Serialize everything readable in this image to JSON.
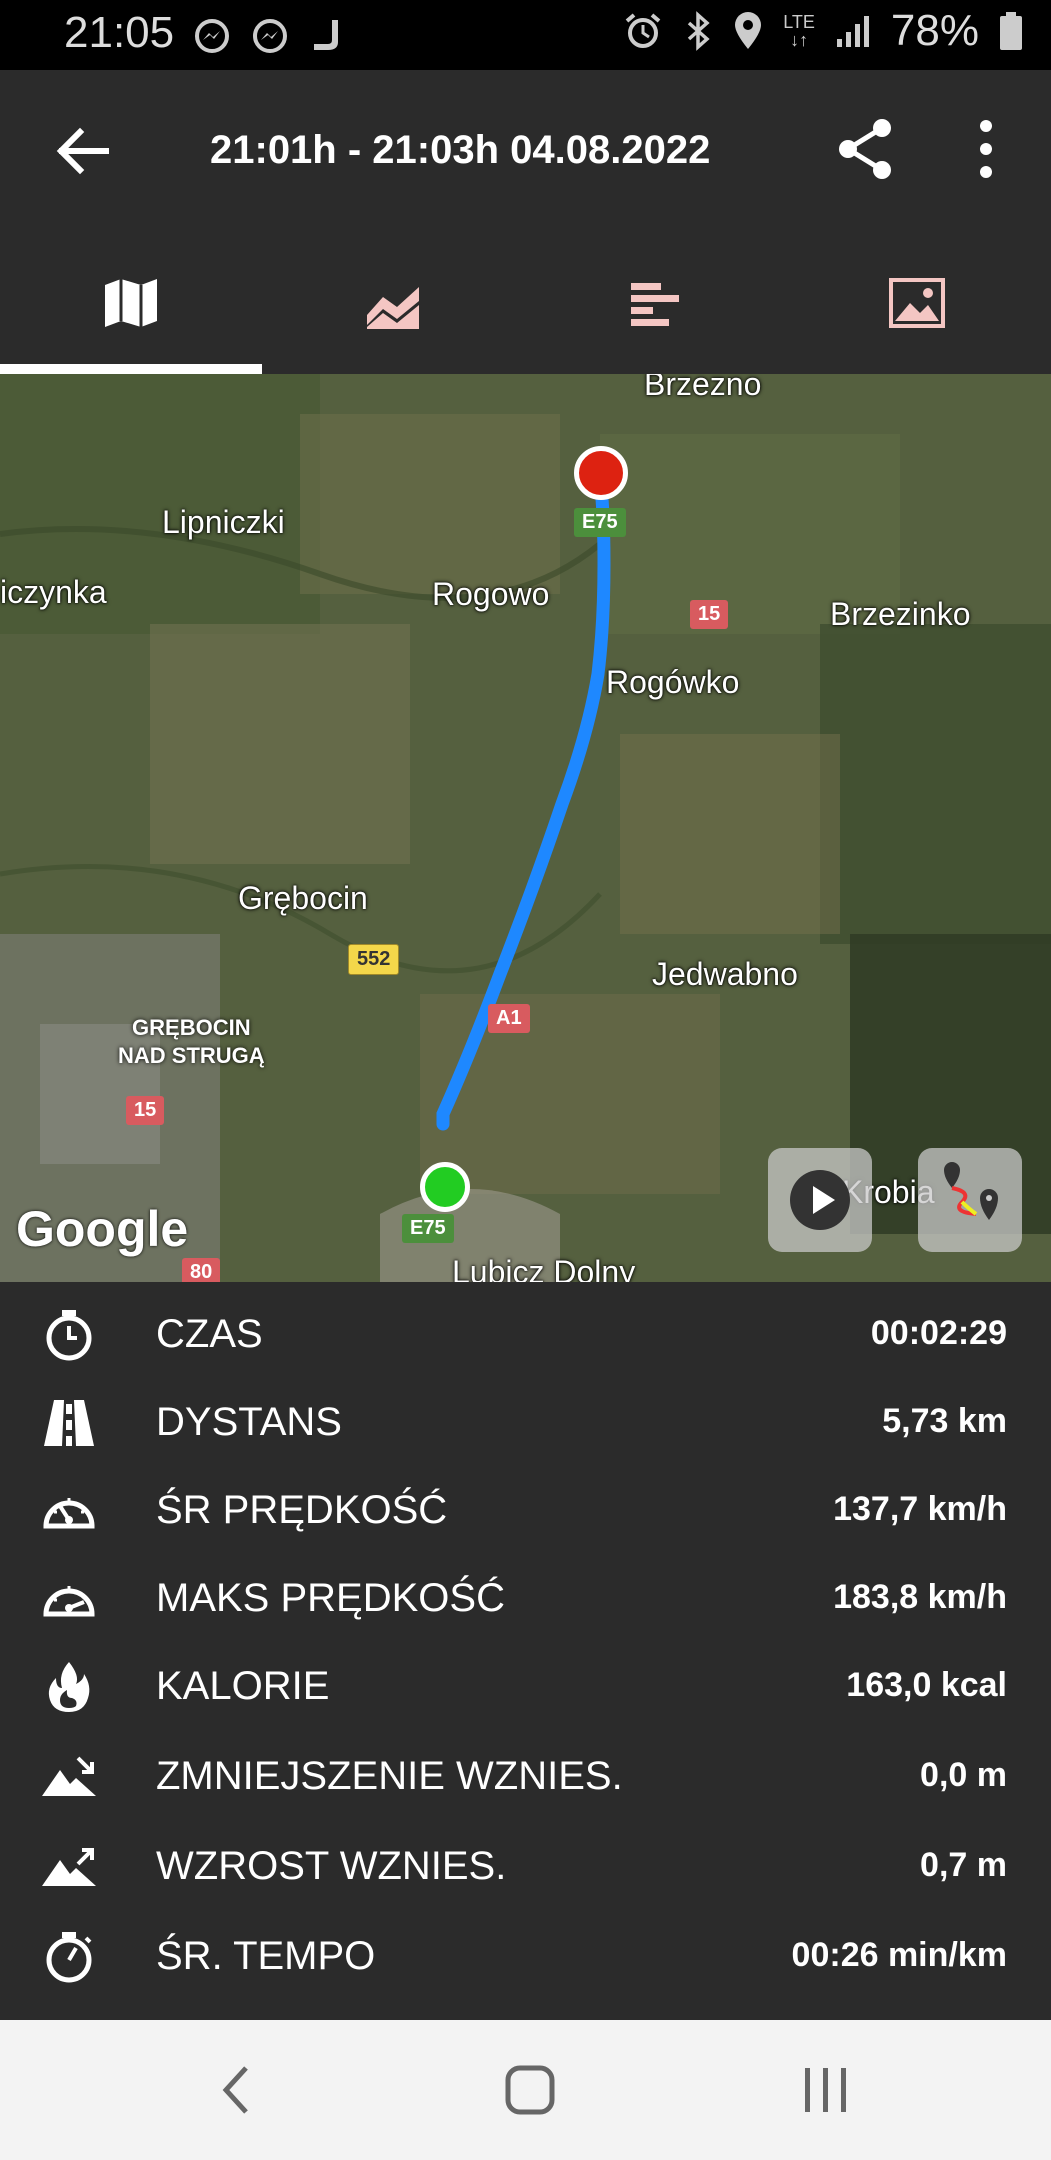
{
  "status_bar": {
    "time": "21:05",
    "left_icons": [
      "messenger-icon",
      "messenger-icon",
      "j-app-icon"
    ],
    "right_icons": [
      "alarm-icon",
      "bluetooth-icon",
      "location-icon",
      "lte-icon",
      "signal-icon"
    ],
    "network": "LTE",
    "battery": "78%"
  },
  "app_bar": {
    "title": "21:01h - 21:03h   04.08.2022"
  },
  "tabs": [
    {
      "name": "map-tab",
      "icon": "map-icon",
      "active": true
    },
    {
      "name": "chart-tab",
      "icon": "area-chart-icon",
      "active": false
    },
    {
      "name": "stats-tab",
      "icon": "bar-list-icon",
      "active": false
    },
    {
      "name": "photos-tab",
      "icon": "image-icon",
      "active": false
    }
  ],
  "colors": {
    "background": "#2b2b2b",
    "tab_icon_inactive": "#f4c6c3",
    "route": "#1e88ff",
    "start_marker": "#22cc22",
    "end_marker": "#dd2211"
  },
  "map": {
    "labels": {
      "brzezno": "Brzezno",
      "lipniczki": "Lipniczki",
      "iczynka": "iczynka",
      "rogowo": "Rogowo",
      "brzezinko": "Brzezinko",
      "rogowko": "Rogówko",
      "grebocin": "Grębocin",
      "jedwabno": "Jedwabno",
      "grebocin_nad_struga": "GRĘBOCIN\nNAD STRUGĄ",
      "krobia": "Krobia",
      "lubicz_dolny": "Lubicz Dolny"
    },
    "shields": {
      "e75_top": "E75",
      "r15_top": "15",
      "r552": "552",
      "a1": "A1",
      "r15_left": "15",
      "e75_bottom": "E75",
      "r80": "80"
    },
    "attribution": "Google"
  },
  "stats": [
    {
      "icon": "stopwatch-icon",
      "label": "CZAS",
      "value": "00:02:29"
    },
    {
      "icon": "road-icon",
      "label": "DYSTANS",
      "value": "5,73 km"
    },
    {
      "icon": "speedometer-icon",
      "label": "ŚR PRĘDKOŚĆ",
      "value": "137,7 km/h"
    },
    {
      "icon": "speedometer-max-icon",
      "label": "MAKS PRĘDKOŚĆ",
      "value": "183,8 km/h"
    },
    {
      "icon": "flame-icon",
      "label": "KALORIE",
      "value": "163,0 kcal"
    },
    {
      "icon": "elevation-down-icon",
      "label": "ZMNIEJSZENIE WZNIES.",
      "value": "0,0 m"
    },
    {
      "icon": "elevation-up-icon",
      "label": "WZROST WZNIES.",
      "value": "0,7 m"
    },
    {
      "icon": "stopwatch-pace-icon",
      "label": "ŚR. TEMPO",
      "value": "00:26 min/km"
    }
  ]
}
